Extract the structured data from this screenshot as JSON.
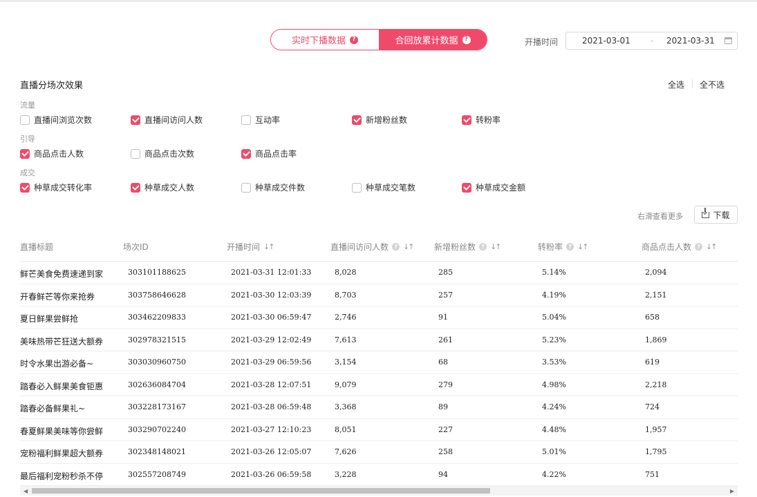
{
  "tabs": {
    "realtime_label": "实时下播数据",
    "cumulative_label": "合回放累计数据",
    "help_glyph": "?"
  },
  "date": {
    "label": "开播时间",
    "start": "2021-03-01",
    "separator": "-",
    "end": "2021-03-31"
  },
  "section": {
    "title": "直播分场次效果",
    "select_all": "全选",
    "select_none": "全不选"
  },
  "groups": {
    "traffic": {
      "label": "流量",
      "items": [
        {
          "label": "直播间浏览次数",
          "checked": false
        },
        {
          "label": "直播间访问人数",
          "checked": true
        },
        {
          "label": "互动率",
          "checked": false
        },
        {
          "label": "新增粉丝数",
          "checked": true
        },
        {
          "label": "转粉率",
          "checked": true
        }
      ]
    },
    "guide": {
      "label": "引导",
      "items": [
        {
          "label": "商品点击人数",
          "checked": true
        },
        {
          "label": "商品点击次数",
          "checked": false
        },
        {
          "label": "商品点击率",
          "checked": true
        }
      ]
    },
    "deal": {
      "label": "成交",
      "items": [
        {
          "label": "种草成交转化率",
          "checked": true
        },
        {
          "label": "种草成交人数",
          "checked": true
        },
        {
          "label": "种草成交件数",
          "checked": false
        },
        {
          "label": "种草成交笔数",
          "checked": false
        },
        {
          "label": "种草成交金额",
          "checked": true
        }
      ]
    }
  },
  "toolbar": {
    "more_hint": "右滑查看更多",
    "download_label": "下载"
  },
  "table": {
    "headers": [
      "直播标题",
      "场次ID",
      "开播时间",
      "直播间访问人数",
      "新增粉丝数",
      "转粉率",
      "商品点击人数"
    ],
    "sort_glyph": "↓↑",
    "info_glyph": "?",
    "rows": [
      [
        "鲜芒美食免费速递到家",
        "303101188625",
        "2021-03-31 12:01:33",
        "8,028",
        "285",
        "5.14%",
        "2,094"
      ],
      [
        "开春鲜芒等你来抢券",
        "303758646628",
        "2021-03-30 12:03:39",
        "8,703",
        "257",
        "4.19%",
        "2,151"
      ],
      [
        "夏日鲜果尝鲜抢",
        "303462209833",
        "2021-03-30 06:59:47",
        "2,746",
        "91",
        "5.04%",
        "658"
      ],
      [
        "美味热带芒狂送大额券",
        "302978321515",
        "2021-03-29 12:02:49",
        "7,613",
        "261",
        "5.23%",
        "1,869"
      ],
      [
        "时令水果出游必备~",
        "303030960750",
        "2021-03-29 06:59:56",
        "3,154",
        "68",
        "3.53%",
        "619"
      ],
      [
        "踏春必入鲜果美食钜惠",
        "302636084704",
        "2021-03-28 12:07:51",
        "9,079",
        "279",
        "4.98%",
        "2,218"
      ],
      [
        "踏春必备鲜果礼~",
        "303228173167",
        "2021-03-28 06:59:48",
        "3,368",
        "89",
        "4.24%",
        "724"
      ],
      [
        "春夏鲜果美味等你尝鲜",
        "303290702240",
        "2021-03-27 12:10:23",
        "8,051",
        "227",
        "4.48%",
        "1,957"
      ],
      [
        "宠粉福利鲜果超大额券",
        "302348148021",
        "2021-03-26 12:05:07",
        "7,626",
        "258",
        "5.01%",
        "1,795"
      ],
      [
        "最后福利宠粉秒杀不停",
        "302557208749",
        "2021-03-26 06:59:58",
        "3,228",
        "94",
        "4.22%",
        "751"
      ]
    ]
  },
  "scroll": {
    "left_arrow": "◀",
    "right_arrow": "▶"
  },
  "colors": {
    "accent": "#f04a6a"
  }
}
